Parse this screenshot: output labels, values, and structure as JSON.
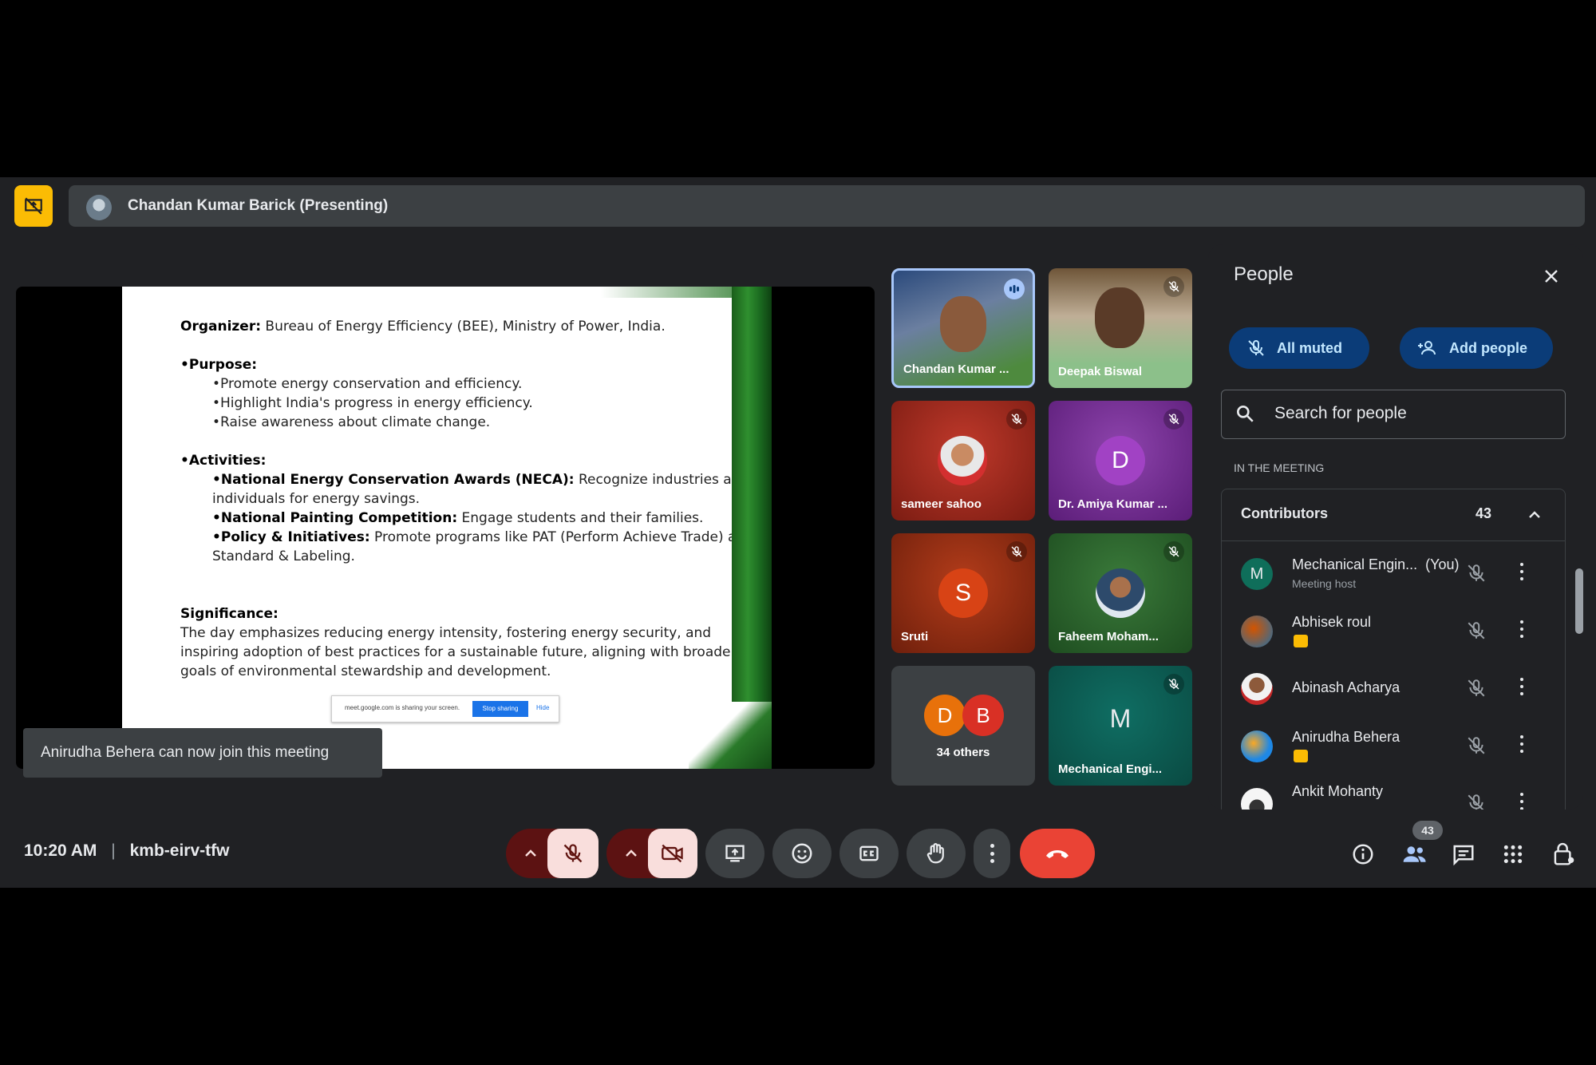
{
  "presenter_bar": {
    "text": "Chandan Kumar Barick (Presenting)"
  },
  "slide": {
    "organizer_label": "Organizer:",
    "organizer_text": " Bureau of Energy Efficiency (BEE), Ministry of Power, India.",
    "purpose_heading": "•Purpose:",
    "purpose_items": [
      "•Promote energy conservation and efficiency.",
      "•Highlight India's progress in energy efficiency.",
      "•Raise awareness about climate change."
    ],
    "activities_heading": "•Activities:",
    "act1_label": "•National Energy Conservation Awards (NECA):",
    "act1_text": " Recognize industries and",
    "act1_text2": "individuals for energy savings.",
    "act2_label": "•National Painting Competition:",
    "act2_text": " Engage students and their families.",
    "act3_label": "•Policy & Initiatives:",
    "act3_text": " Promote programs like PAT (Perform Achieve Trade) and",
    "act3_text2": "Standard & Labeling.",
    "significance_heading": "Significance:",
    "significance_lines": [
      "The day emphasizes reducing energy intensity, fostering energy security, and",
      "inspiring adoption of best practices for a sustainable future, aligning with broader",
      "goals of environmental stewardship and development."
    ],
    "share_notice": "meet.google.com is sharing your screen.",
    "share_stop": "Stop sharing",
    "share_hide": "Hide"
  },
  "toast": {
    "text": "Anirudha Behera can now join this meeting"
  },
  "tiles": [
    {
      "name": "Chandan Kumar ..."
    },
    {
      "name": "Deepak Biswal"
    },
    {
      "name": "sameer sahoo"
    },
    {
      "name": "Dr. Amiya Kumar ...",
      "letter": "D"
    },
    {
      "name": "Sruti",
      "letter": "S"
    },
    {
      "name": "Faheem Moham..."
    },
    {
      "name": "34 others",
      "letters": [
        "D",
        "B"
      ]
    },
    {
      "name": "Mechanical Engi...",
      "letter": "M"
    }
  ],
  "people_panel": {
    "title": "People",
    "all_muted": "All muted",
    "add_people": "Add people",
    "search_placeholder": "Search for people",
    "section_label": "IN THE MEETING",
    "contributors_label": "Contributors",
    "contributors_count": "43",
    "people": [
      {
        "name": "Mechanical Engin...",
        "you": "(You)",
        "sub": "Meeting host",
        "letter": "M"
      },
      {
        "name": "Abhisek roul"
      },
      {
        "name": "Abinash Acharya"
      },
      {
        "name": "Anirudha Behera"
      },
      {
        "name": "Ankit Mohanty"
      }
    ]
  },
  "bottom_bar": {
    "time": "10:20 AM",
    "separator": "|",
    "meeting_code": "kmb-eirv-tfw",
    "people_count": "43"
  },
  "colors": {
    "accent_yellow": "#fbbc04",
    "end_call": "#ea4335",
    "muted_red": "#f9dedc",
    "pill_blue": "#0b3c78"
  }
}
